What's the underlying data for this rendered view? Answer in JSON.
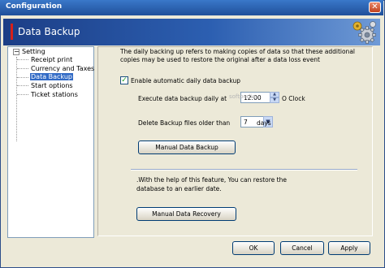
{
  "window": {
    "title": "Configuration",
    "close_glyph": "✕"
  },
  "banner": {
    "title": "Data Backup",
    "icon": "gears-icon"
  },
  "tree": {
    "root": "Setting",
    "items": [
      "Receipt print",
      "Currency and Taxes",
      "Data Backup",
      "Start options",
      "Ticket stations"
    ],
    "selected": "Data Backup"
  },
  "backup": {
    "description": "The daily backing up refers to making copies of data so that these additional copies may be used to restore the original after a data loss event",
    "enable_label": "Enable automatic daily data backup",
    "enable_checked": true,
    "execute_label": "Execute data backup daily at",
    "execute_time": "12:00",
    "execute_suffix": "O Clock",
    "delete_label": "Delete Backup files older than",
    "delete_days": "7",
    "delete_suffix": "days",
    "manual_backup_button": "Manual Data Backup"
  },
  "recovery": {
    "help_text": ".With the help of this feature, You can restore the database to an earlier date.",
    "manual_recovery_button": "Manual Data Recovery"
  },
  "footer": {
    "ok": "OK",
    "cancel": "Cancel",
    "apply": "Apply"
  },
  "watermark": "softpedia"
}
